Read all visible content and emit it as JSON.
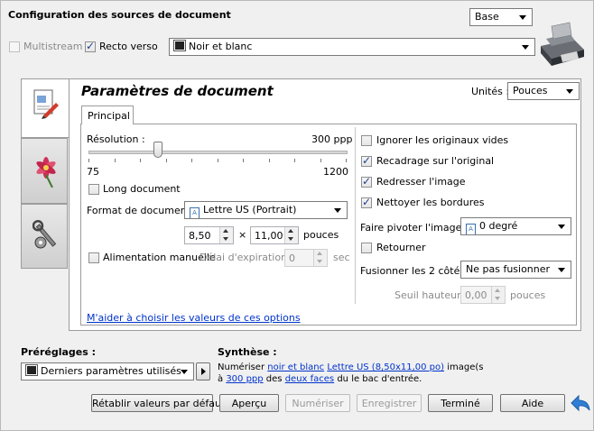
{
  "header": {
    "title": "Configuration des sources de document",
    "mode_select": "Base",
    "multistream_label": "Multistream",
    "duplex_label": "Recto verso",
    "color_select": "Noir et blanc"
  },
  "panel": {
    "title": "Paramètres de document",
    "units_label": "Unités :",
    "units_select": "Pouces",
    "tab_label": "Principal"
  },
  "left": {
    "resolution_label": "Résolution :",
    "resolution_value": "300 ppp",
    "resolution_min": "75",
    "resolution_max": "1200",
    "resolution_level": 0.27,
    "long_document_label": "Long document",
    "format_label": "Format de document :",
    "format_select": "Lettre US (Portrait)",
    "width_value": "8,50",
    "times": "×",
    "height_value": "11,00",
    "size_unit": "pouces",
    "manual_feed_label": "Alimentation manuelle",
    "timeout_label": "Délai d'expiration :",
    "timeout_value": "0",
    "timeout_unit": "sec",
    "help_link": "M'aider à choisir les valeurs de ces options"
  },
  "right": {
    "ignore_blank_label": "Ignorer les originaux vides",
    "crop_label": "Recadrage sur l'original",
    "deskew_label": "Redresser l'image",
    "clean_edges_label": "Nettoyer les bordures",
    "rotate_label": "Faire pivoter l'image :",
    "rotate_select": "0 degré",
    "flip_label": "Retourner",
    "merge_label": "Fusionner les 2 côtés :",
    "merge_select": "Ne pas fusionner",
    "height_threshold_label": "Seuil hauteur :",
    "height_threshold_value": "0,00",
    "height_threshold_unit": "pouces"
  },
  "presets": {
    "label": "Préréglages :",
    "select": "Derniers paramètres utilisés"
  },
  "summary": {
    "label": "Synthèse :",
    "line1_prefix": "Numériser ",
    "line1_link1": "noir et blanc",
    "line1_link2": "Lettre US (8,50x11,00 po)",
    "line1_suffix": " image(s",
    "line2_prefix": "à ",
    "line2_link1": "300 ppp",
    "line2_mid": " des ",
    "line2_link2": "deux faces",
    "line2_suffix": " du le bac d'entrée."
  },
  "buttons": {
    "reset": "Rétablir valeurs par défaut",
    "preview": "Aperçu",
    "scan": "Numériser",
    "save": "Enregistrer",
    "done": "Terminé",
    "help": "Aide"
  }
}
